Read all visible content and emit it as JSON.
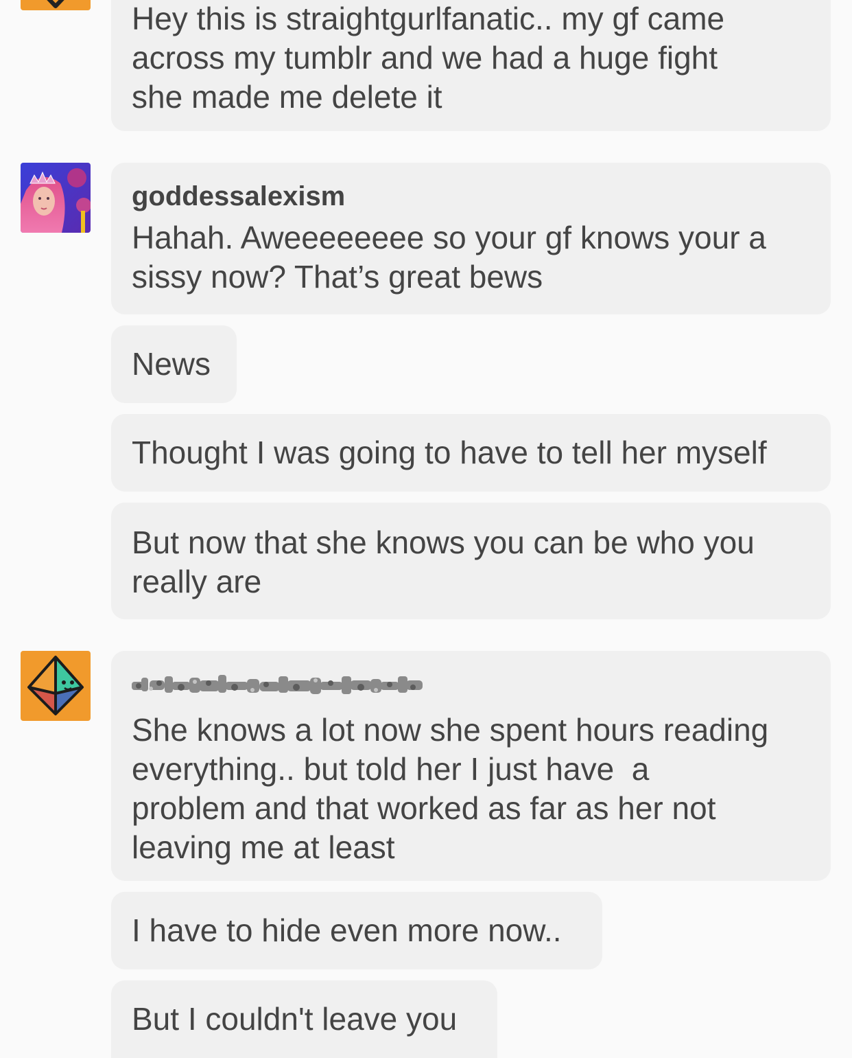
{
  "conversation": {
    "messages": [
      {
        "text": "Hey this is straightgurlfanatic.. my gf came\nacross my tumblr and we had a huge fight\nshe made me delete it"
      },
      {
        "sender": "goddessalexism",
        "text": "Hahah. Aweeeeeeee so your gf knows your a\nsissy now? That’s great bews"
      },
      {
        "text": "News"
      },
      {
        "text": "Thought I was going to have to tell her myself"
      },
      {
        "text": "But now that she knows you can be who you\nreally are"
      },
      {
        "sender_redacted": true,
        "text": "She knows a lot now she spent hours reading\neverything.. but told her I just have  a\nproblem and that worked as far as her not\nleaving me at least"
      },
      {
        "text": "I have to hide even more now.."
      },
      {
        "text": "But I couldn't leave you"
      }
    ]
  },
  "colors": {
    "background": "#fafafa",
    "bubble": "#f0f0f0",
    "text": "#444444",
    "avatar_orange": "#f19a2c"
  },
  "icons": {
    "avatar_1": "orange-avatar-icon",
    "avatar_2": "profile-photo-avatar",
    "avatar_3": "octahedron-default-avatar-icon"
  }
}
